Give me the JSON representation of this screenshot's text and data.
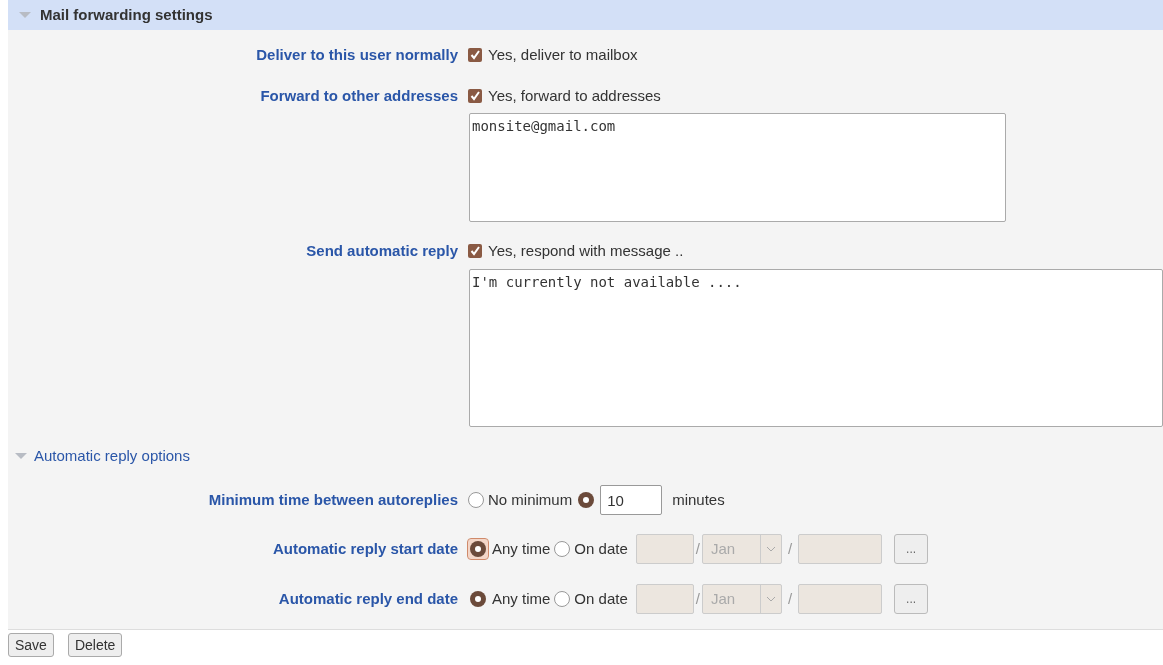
{
  "section": {
    "title": "Mail forwarding settings",
    "expanded": true
  },
  "options": [
    {
      "label": "Deliver to this user normally",
      "checkbox": "Yes, deliver to mailbox",
      "checked": true
    },
    {
      "label": "Forward to other addresses",
      "checkbox": "Yes, forward to addresses",
      "checked": true,
      "textarea": "monsite@gmail.com",
      "wide": false
    },
    {
      "label": "Send automatic reply",
      "checkbox": "Yes, respond with message ..",
      "checked": true,
      "textarea": "I'm currently not available ....",
      "wide": true
    }
  ],
  "subsection": {
    "title": "Automatic reply options",
    "expanded": true
  },
  "min_time": {
    "label": "Minimum time between autoreplies",
    "no_minimum": "No minimum",
    "no_minimum_selected": false,
    "value_selected": true,
    "value": "10",
    "unit": "minutes"
  },
  "dates": [
    {
      "label": "Automatic reply start date",
      "any": "Any time",
      "any_selected": true,
      "focused": true,
      "on": "On date",
      "on_selected": false,
      "month": "Jan",
      "sep1": "/",
      "sep2": "/",
      "picker": "..."
    },
    {
      "label": "Automatic reply end date",
      "any": "Any time",
      "any_selected": true,
      "focused": false,
      "on": "On date",
      "on_selected": false,
      "month": "Jan",
      "sep1": "/",
      "sep2": "/",
      "picker": "..."
    }
  ],
  "buttons": [
    "Save",
    "Delete"
  ]
}
